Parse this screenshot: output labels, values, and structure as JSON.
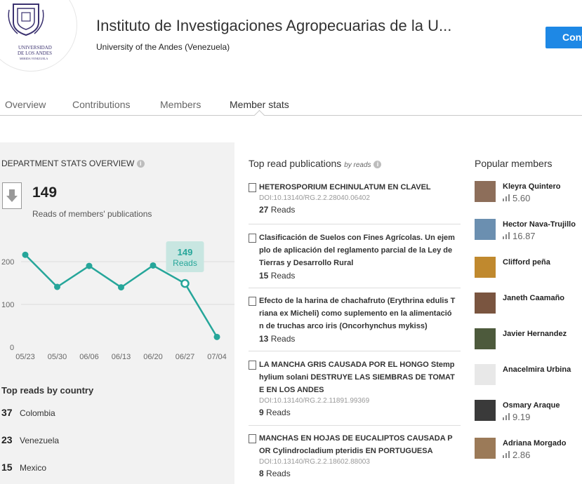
{
  "header": {
    "logo": {
      "icon": "university-seal",
      "line1": "UNIVERSIDAD",
      "line2": "DE LOS ANDES",
      "line3": "MERIDA VENEZUELA"
    },
    "title": "Instituto de Investigaciones Agropecuarias de la U...",
    "subtitle": "University of the Andes (Venezuela)",
    "follow_label": "Conf"
  },
  "tabs": [
    "Overview",
    "Contributions",
    "Members",
    "Member stats"
  ],
  "stats": {
    "heading": "DEPARTMENT STATS OVERVIEW",
    "total_reads": "149",
    "total_label": "Reads of members' publications",
    "tooltip_value": "149",
    "tooltip_label": "Reads",
    "accent_color": "#26a69a"
  },
  "chart_data": {
    "type": "line",
    "x": [
      "05/23",
      "05/30",
      "06/06",
      "06/13",
      "06/20",
      "06/27",
      "07/04"
    ],
    "y_ticks": [
      "200",
      "100",
      "0"
    ],
    "values": [
      216,
      141,
      190,
      140,
      191,
      149,
      24
    ],
    "ylim": [
      0,
      200
    ],
    "highlight_index": 5
  },
  "countries": {
    "heading": "Top reads by country",
    "rows": [
      {
        "count": "37",
        "name": "Colombia"
      },
      {
        "count": "23",
        "name": "Venezuela"
      },
      {
        "count": "15",
        "name": "Mexico"
      }
    ]
  },
  "publications": {
    "heading": "Top read publications",
    "heading_sub": "by reads",
    "items": [
      {
        "lines": [
          "HETEROSPORIUM ECHINULATUM EN CLAVEL"
        ],
        "doi": "DOI:10.13140/RG.2.2.28040.06402",
        "reads": "27",
        "reads_label": "Reads"
      },
      {
        "lines": [
          "Clasificación de Suelos con Fines Agrícolas. Un ejem",
          "plo de aplicación del reglamento parcial de la Ley de",
          "Tierras y Desarrollo Rural"
        ],
        "doi": "",
        "reads": "15",
        "reads_label": "Reads"
      },
      {
        "lines": [
          "Efecto de la harina de chachafruto (Erythrina edulis T",
          "riana ex Micheli) como suplemento en la alimentació",
          "n de truchas arco iris (Oncorhynchus mykiss)"
        ],
        "doi": "",
        "reads": "13",
        "reads_label": "Reads"
      },
      {
        "lines": [
          "LA MANCHA GRIS CAUSADA POR EL HONGO Stemp",
          "hylium solani DESTRUYE LAS SIEMBRAS DE TOMAT",
          "E EN LOS ANDES"
        ],
        "doi": "DOI:10.13140/RG.2.2.11891.99369",
        "reads": "9",
        "reads_label": "Reads"
      },
      {
        "lines": [
          "MANCHAS EN HOJAS DE EUCALIPTOS CAUSADA P",
          "OR Cylindrocladium pteridis EN PORTUGUESA"
        ],
        "doi": "DOI:10.13140/RG.2.2.18602.88003",
        "reads": "8",
        "reads_label": "Reads"
      }
    ]
  },
  "members": {
    "heading": "Popular members",
    "items": [
      {
        "name": "Kleyra Quintero",
        "score": "5.60",
        "avatar": "#8d6e5a"
      },
      {
        "name": "Hector Nava-Trujillo",
        "score": "16.87",
        "avatar": "#6b8fb0"
      },
      {
        "name": "Clifford peña",
        "score": "",
        "avatar": "#c0892e"
      },
      {
        "name": "Janeth Caamaño",
        "score": "",
        "avatar": "#7a5540"
      },
      {
        "name": "Javier Hernandez",
        "score": "",
        "avatar": "#4d5a3c"
      },
      {
        "name": "Anacelmira Urbina",
        "score": "",
        "avatar": "#e8e8e8"
      },
      {
        "name": "Osmary Araque",
        "score": "9.19",
        "avatar": "#3a3a3a"
      },
      {
        "name": "Adriana Morgado",
        "score": "2.86",
        "avatar": "#9b7a58"
      }
    ]
  }
}
